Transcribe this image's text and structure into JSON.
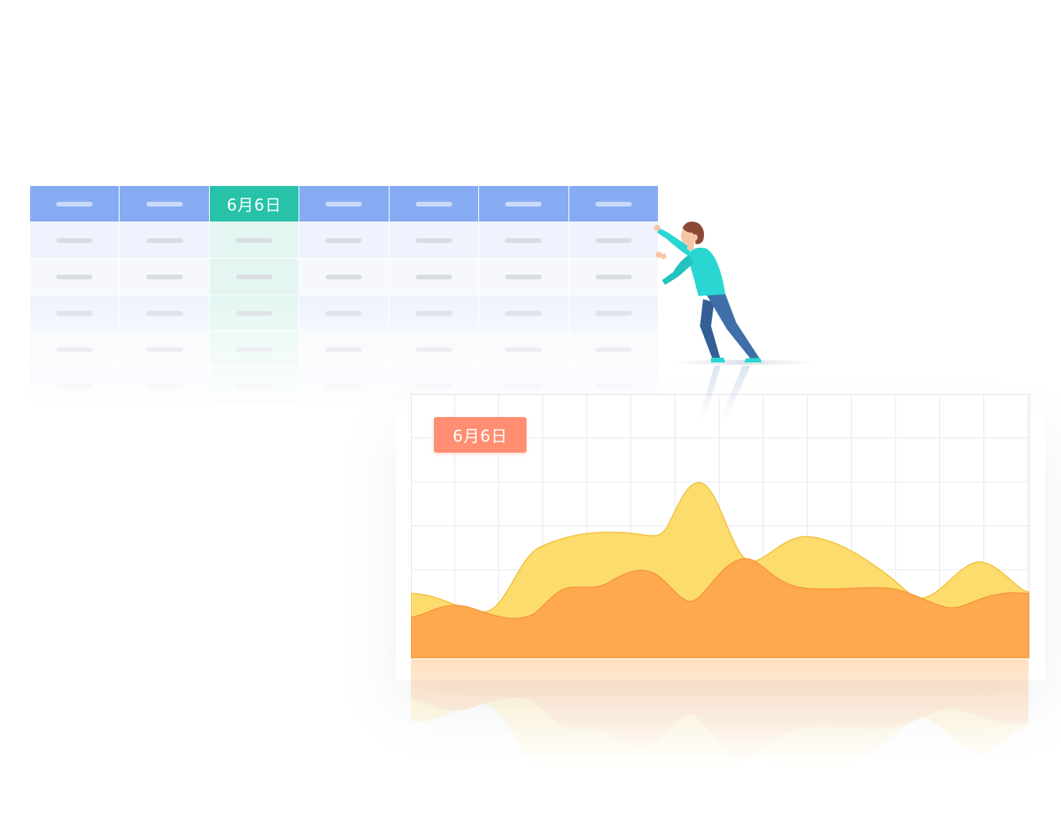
{
  "table": {
    "highlight_column": 2,
    "header_label": "6月6日",
    "columns": 7,
    "body_rows": 5,
    "colors": {
      "header": "#87abf3",
      "highlight": "#27c2a8",
      "highlight_tint": "#e3f6f1"
    }
  },
  "chart": {
    "badge_label": "6月6日",
    "colors": {
      "badge": "#ff8e73",
      "back_area": "#fddc6e",
      "front_area": "#fea84f",
      "grid": "#e6e8ef"
    },
    "grid": true
  },
  "figure": {
    "colors": {
      "shirt": "#2ad6d2",
      "pants": "#3f6ea8",
      "hair": "#8a4a35",
      "skin": "#f6c7a7",
      "shoes": "#2ad6d2"
    }
  }
}
